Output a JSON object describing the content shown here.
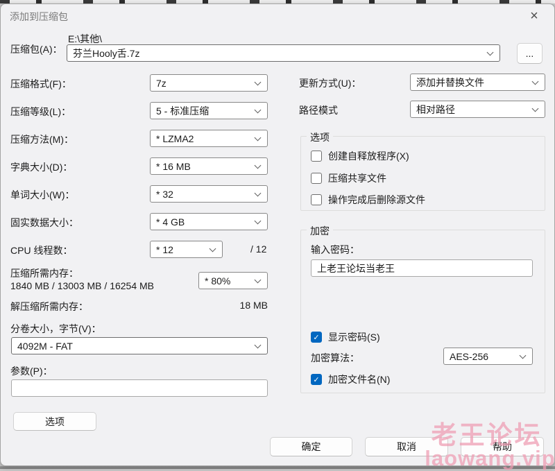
{
  "window": {
    "title": "添加到压缩包",
    "close_glyph": "×"
  },
  "archive": {
    "label": "压缩包(A)：",
    "path": "E:\\其他\\",
    "filename": "芬兰Hooly舌.7z",
    "browse_label": "..."
  },
  "left_fields": [
    {
      "label": "压缩格式(F)：",
      "value": "7z"
    },
    {
      "label": "压缩等级(L)：",
      "value": "5 - 标准压缩"
    },
    {
      "label": "压缩方法(M)：",
      "value": "* LZMA2"
    },
    {
      "label": "字典大小(D)：",
      "value": "* 16 MB"
    },
    {
      "label": "单词大小(W)：",
      "value": "* 32"
    },
    {
      "label": "固实数据大小：",
      "value": "* 4 GB"
    }
  ],
  "cpu": {
    "label": "CPU 线程数：",
    "value": "* 12",
    "suffix": "/ 12"
  },
  "memory": {
    "label": "压缩所需内存：",
    "detail": "1840 MB / 13003 MB / 16254 MB",
    "value": "* 80%"
  },
  "decompress_memory": {
    "label": "解压缩所需内存：",
    "value": "18 MB"
  },
  "volume": {
    "label": "分卷大小，字节(V)：",
    "value": "4092M - FAT"
  },
  "parameters": {
    "label": "参数(P)：",
    "value": ""
  },
  "options_button_label": "选项",
  "right_fields": [
    {
      "label": "更新方式(U)：",
      "value": "添加并替换文件"
    },
    {
      "label": "路径模式",
      "value": "相对路径"
    }
  ],
  "options_group": {
    "title": "选项",
    "checkboxes": [
      {
        "label": "创建自释放程序(X)",
        "checked": false
      },
      {
        "label": "压缩共享文件",
        "checked": false
      },
      {
        "label": "操作完成后删除源文件",
        "checked": false
      }
    ]
  },
  "encryption_group": {
    "title": "加密",
    "password_label": "输入密码：",
    "password_value": "上老王论坛当老王",
    "show_password": {
      "label": "显示密码(S)",
      "checked": true
    },
    "method": {
      "label": "加密算法：",
      "value": "AES-256"
    },
    "encrypt_names": {
      "label": "加密文件名(N)",
      "checked": true
    }
  },
  "footer": {
    "ok": "确定",
    "cancel": "取消",
    "help": "帮助"
  },
  "watermark": {
    "line1": "老王论坛",
    "line2": "laowang.vip"
  },
  "colors": {
    "accent": "#0067c0",
    "watermark_pink": "#ef9cb2",
    "check_icon": "✓"
  }
}
